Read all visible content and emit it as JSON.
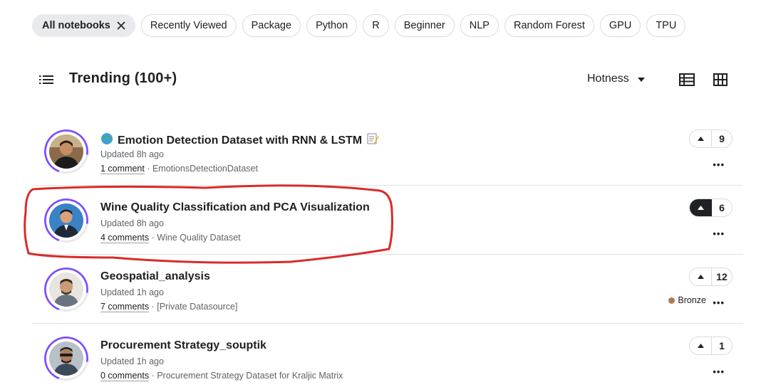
{
  "filters": {
    "active": "All notebooks",
    "chips": [
      "Recently Viewed",
      "Package",
      "Python",
      "R",
      "Beginner",
      "NLP",
      "Random Forest",
      "GPU",
      "TPU"
    ]
  },
  "header": {
    "title": "Trending (100+)",
    "sort_label": "Hotness"
  },
  "notebooks": [
    {
      "title": "Emotion Detection Dataset with RNN & LSTM",
      "updated": "Updated 8h ago",
      "comments": "1 comment",
      "dataset": "EmotionsDetectionDataset",
      "votes": "9",
      "voted": false,
      "medal": null,
      "ring_fraction": 0.72,
      "ring_color": "#7c4dff"
    },
    {
      "title": "Wine Quality Classification and PCA Visualization",
      "updated": "Updated 8h ago",
      "comments": "4 comments",
      "dataset": "Wine Quality Dataset",
      "votes": "6",
      "voted": true,
      "medal": null,
      "ring_fraction": 0.72,
      "ring_color": "#7c4dff"
    },
    {
      "title": "Geospatial_analysis",
      "updated": "Updated 1h ago",
      "comments": "7 comments",
      "dataset": "[Private Datasource]",
      "votes": "12",
      "voted": false,
      "medal": "Bronze",
      "ring_fraction": 0.72,
      "ring_color": "#7c4dff"
    },
    {
      "title": "Procurement Strategy_souptik",
      "updated": "Updated 1h ago",
      "comments": "0 comments",
      "dataset": "Procurement Strategy Dataset for Kraljic Matrix",
      "votes": "1",
      "voted": false,
      "medal": null,
      "ring_fraction": 0.72,
      "ring_color": "#7c4dff"
    }
  ],
  "annotation_color": "#d92b2b",
  "accent": "#7c4dff"
}
